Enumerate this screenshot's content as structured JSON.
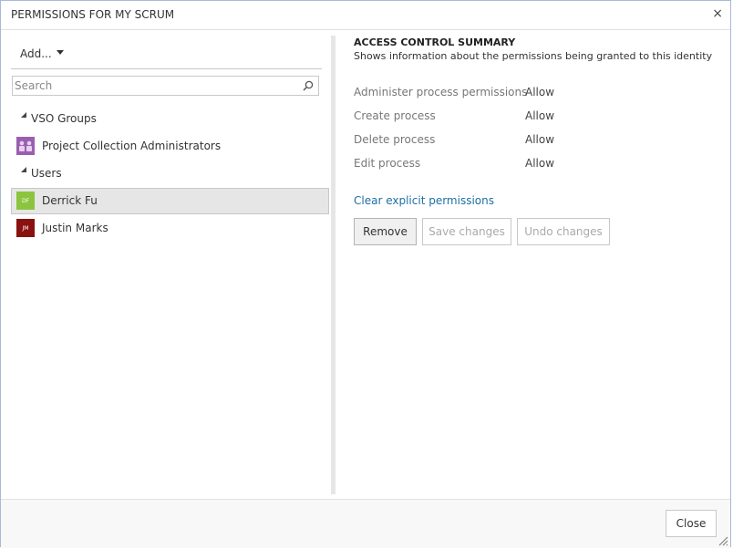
{
  "dialog": {
    "title": "PERMISSIONS FOR MY SCRUM",
    "close_glyph": "×"
  },
  "left": {
    "add_label": "Add...",
    "search_placeholder": "Search",
    "groups": [
      {
        "label": "VSO Groups",
        "items": [
          {
            "label": "Project Collection Administrators",
            "icon": "group-icon",
            "color": "#9b5fb0"
          }
        ]
      },
      {
        "label": "Users",
        "items": [
          {
            "label": "Derrick Fu",
            "initials": "DF",
            "color": "#8cc43f",
            "selected": true
          },
          {
            "label": "Justin Marks",
            "initials": "JM",
            "color": "#8b1111",
            "selected": false
          }
        ]
      }
    ]
  },
  "right": {
    "section_title": "ACCESS CONTROL SUMMARY",
    "section_subtitle": "Shows information about the permissions being granted to this identity",
    "permissions": [
      {
        "name": "Administer process permissions",
        "value": "Allow"
      },
      {
        "name": "Create process",
        "value": "Allow"
      },
      {
        "name": "Delete process",
        "value": "Allow"
      },
      {
        "name": "Edit process",
        "value": "Allow"
      }
    ],
    "clear_link": "Clear explicit permissions",
    "buttons": {
      "remove": "Remove",
      "save": "Save changes",
      "undo": "Undo changes"
    }
  },
  "footer": {
    "close_label": "Close"
  },
  "colors": {
    "link": "#1d6fa5",
    "selected_row": "#e6e6e6",
    "dialog_border": "#a6b9d6"
  }
}
